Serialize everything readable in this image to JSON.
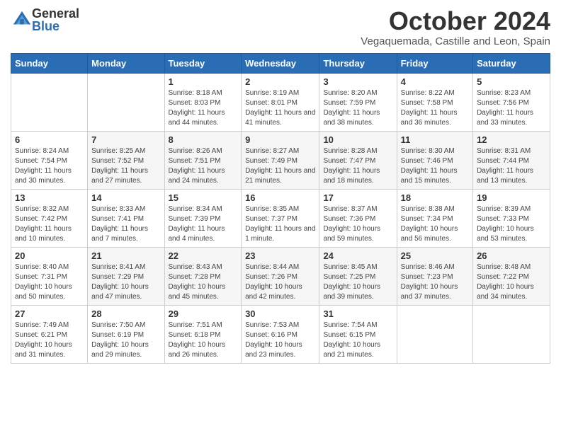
{
  "logo": {
    "general": "General",
    "blue": "Blue"
  },
  "title": "October 2024",
  "subtitle": "Vegaquemada, Castille and Leon, Spain",
  "days_header": [
    "Sunday",
    "Monday",
    "Tuesday",
    "Wednesday",
    "Thursday",
    "Friday",
    "Saturday"
  ],
  "weeks": [
    [
      {
        "num": "",
        "sunrise": "",
        "sunset": "",
        "daylight": ""
      },
      {
        "num": "",
        "sunrise": "",
        "sunset": "",
        "daylight": ""
      },
      {
        "num": "1",
        "sunrise": "Sunrise: 8:18 AM",
        "sunset": "Sunset: 8:03 PM",
        "daylight": "Daylight: 11 hours and 44 minutes."
      },
      {
        "num": "2",
        "sunrise": "Sunrise: 8:19 AM",
        "sunset": "Sunset: 8:01 PM",
        "daylight": "Daylight: 11 hours and 41 minutes."
      },
      {
        "num": "3",
        "sunrise": "Sunrise: 8:20 AM",
        "sunset": "Sunset: 7:59 PM",
        "daylight": "Daylight: 11 hours and 38 minutes."
      },
      {
        "num": "4",
        "sunrise": "Sunrise: 8:22 AM",
        "sunset": "Sunset: 7:58 PM",
        "daylight": "Daylight: 11 hours and 36 minutes."
      },
      {
        "num": "5",
        "sunrise": "Sunrise: 8:23 AM",
        "sunset": "Sunset: 7:56 PM",
        "daylight": "Daylight: 11 hours and 33 minutes."
      }
    ],
    [
      {
        "num": "6",
        "sunrise": "Sunrise: 8:24 AM",
        "sunset": "Sunset: 7:54 PM",
        "daylight": "Daylight: 11 hours and 30 minutes."
      },
      {
        "num": "7",
        "sunrise": "Sunrise: 8:25 AM",
        "sunset": "Sunset: 7:52 PM",
        "daylight": "Daylight: 11 hours and 27 minutes."
      },
      {
        "num": "8",
        "sunrise": "Sunrise: 8:26 AM",
        "sunset": "Sunset: 7:51 PM",
        "daylight": "Daylight: 11 hours and 24 minutes."
      },
      {
        "num": "9",
        "sunrise": "Sunrise: 8:27 AM",
        "sunset": "Sunset: 7:49 PM",
        "daylight": "Daylight: 11 hours and 21 minutes."
      },
      {
        "num": "10",
        "sunrise": "Sunrise: 8:28 AM",
        "sunset": "Sunset: 7:47 PM",
        "daylight": "Daylight: 11 hours and 18 minutes."
      },
      {
        "num": "11",
        "sunrise": "Sunrise: 8:30 AM",
        "sunset": "Sunset: 7:46 PM",
        "daylight": "Daylight: 11 hours and 15 minutes."
      },
      {
        "num": "12",
        "sunrise": "Sunrise: 8:31 AM",
        "sunset": "Sunset: 7:44 PM",
        "daylight": "Daylight: 11 hours and 13 minutes."
      }
    ],
    [
      {
        "num": "13",
        "sunrise": "Sunrise: 8:32 AM",
        "sunset": "Sunset: 7:42 PM",
        "daylight": "Daylight: 11 hours and 10 minutes."
      },
      {
        "num": "14",
        "sunrise": "Sunrise: 8:33 AM",
        "sunset": "Sunset: 7:41 PM",
        "daylight": "Daylight: 11 hours and 7 minutes."
      },
      {
        "num": "15",
        "sunrise": "Sunrise: 8:34 AM",
        "sunset": "Sunset: 7:39 PM",
        "daylight": "Daylight: 11 hours and 4 minutes."
      },
      {
        "num": "16",
        "sunrise": "Sunrise: 8:35 AM",
        "sunset": "Sunset: 7:37 PM",
        "daylight": "Daylight: 11 hours and 1 minute."
      },
      {
        "num": "17",
        "sunrise": "Sunrise: 8:37 AM",
        "sunset": "Sunset: 7:36 PM",
        "daylight": "Daylight: 10 hours and 59 minutes."
      },
      {
        "num": "18",
        "sunrise": "Sunrise: 8:38 AM",
        "sunset": "Sunset: 7:34 PM",
        "daylight": "Daylight: 10 hours and 56 minutes."
      },
      {
        "num": "19",
        "sunrise": "Sunrise: 8:39 AM",
        "sunset": "Sunset: 7:33 PM",
        "daylight": "Daylight: 10 hours and 53 minutes."
      }
    ],
    [
      {
        "num": "20",
        "sunrise": "Sunrise: 8:40 AM",
        "sunset": "Sunset: 7:31 PM",
        "daylight": "Daylight: 10 hours and 50 minutes."
      },
      {
        "num": "21",
        "sunrise": "Sunrise: 8:41 AM",
        "sunset": "Sunset: 7:29 PM",
        "daylight": "Daylight: 10 hours and 47 minutes."
      },
      {
        "num": "22",
        "sunrise": "Sunrise: 8:43 AM",
        "sunset": "Sunset: 7:28 PM",
        "daylight": "Daylight: 10 hours and 45 minutes."
      },
      {
        "num": "23",
        "sunrise": "Sunrise: 8:44 AM",
        "sunset": "Sunset: 7:26 PM",
        "daylight": "Daylight: 10 hours and 42 minutes."
      },
      {
        "num": "24",
        "sunrise": "Sunrise: 8:45 AM",
        "sunset": "Sunset: 7:25 PM",
        "daylight": "Daylight: 10 hours and 39 minutes."
      },
      {
        "num": "25",
        "sunrise": "Sunrise: 8:46 AM",
        "sunset": "Sunset: 7:23 PM",
        "daylight": "Daylight: 10 hours and 37 minutes."
      },
      {
        "num": "26",
        "sunrise": "Sunrise: 8:48 AM",
        "sunset": "Sunset: 7:22 PM",
        "daylight": "Daylight: 10 hours and 34 minutes."
      }
    ],
    [
      {
        "num": "27",
        "sunrise": "Sunrise: 7:49 AM",
        "sunset": "Sunset: 6:21 PM",
        "daylight": "Daylight: 10 hours and 31 minutes."
      },
      {
        "num": "28",
        "sunrise": "Sunrise: 7:50 AM",
        "sunset": "Sunset: 6:19 PM",
        "daylight": "Daylight: 10 hours and 29 minutes."
      },
      {
        "num": "29",
        "sunrise": "Sunrise: 7:51 AM",
        "sunset": "Sunset: 6:18 PM",
        "daylight": "Daylight: 10 hours and 26 minutes."
      },
      {
        "num": "30",
        "sunrise": "Sunrise: 7:53 AM",
        "sunset": "Sunset: 6:16 PM",
        "daylight": "Daylight: 10 hours and 23 minutes."
      },
      {
        "num": "31",
        "sunrise": "Sunrise: 7:54 AM",
        "sunset": "Sunset: 6:15 PM",
        "daylight": "Daylight: 10 hours and 21 minutes."
      },
      {
        "num": "",
        "sunrise": "",
        "sunset": "",
        "daylight": ""
      },
      {
        "num": "",
        "sunrise": "",
        "sunset": "",
        "daylight": ""
      }
    ]
  ]
}
